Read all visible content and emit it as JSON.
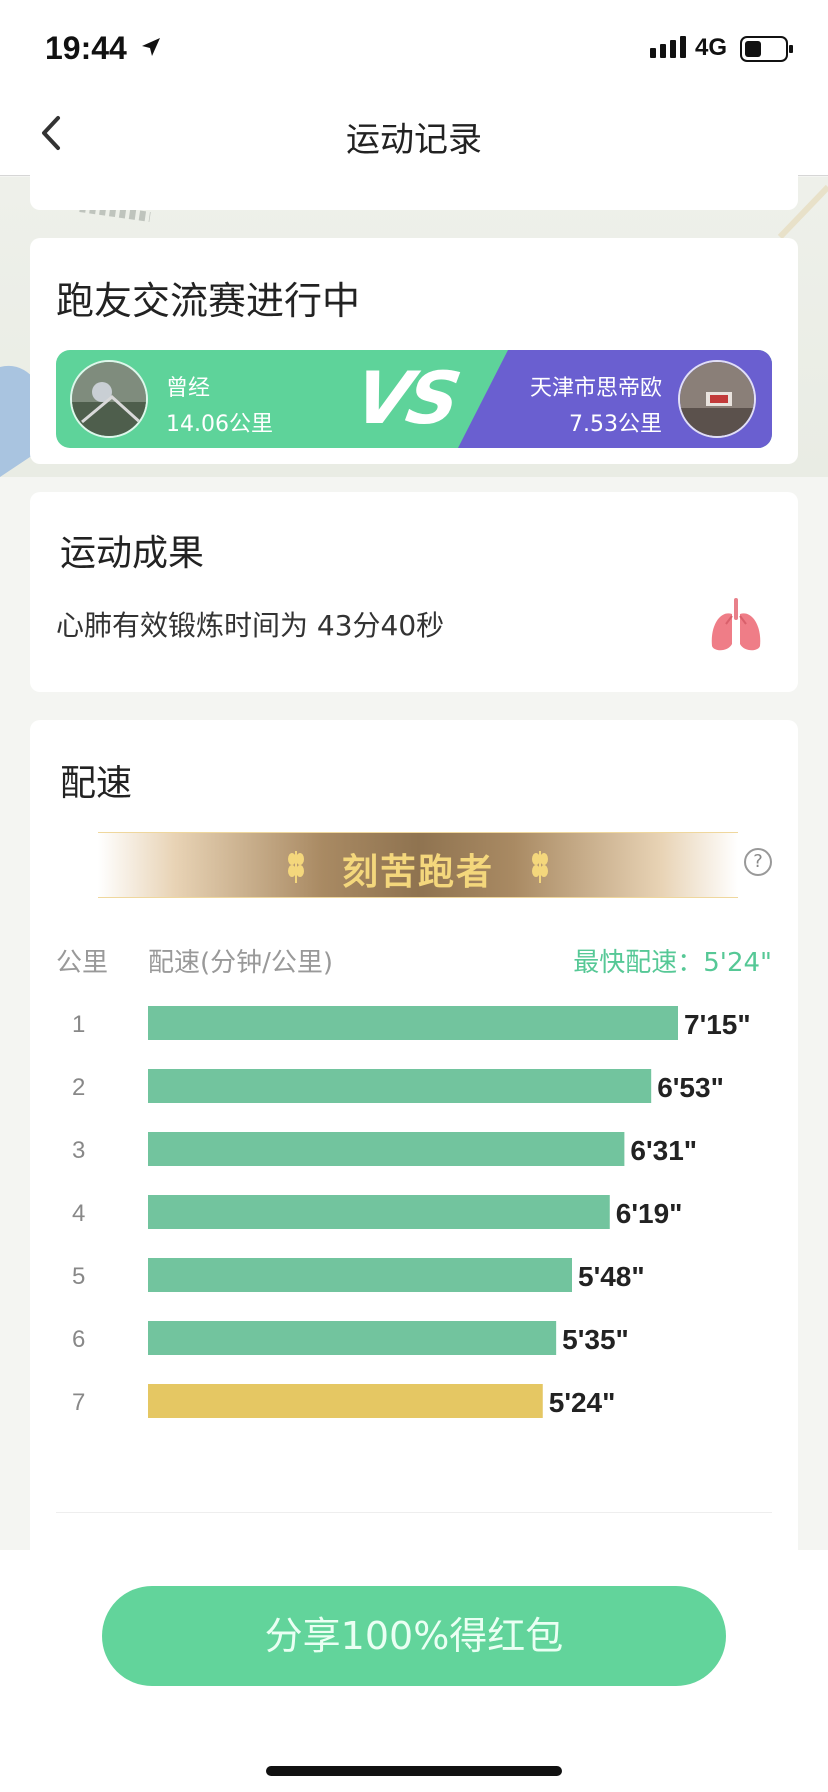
{
  "status_bar": {
    "time": "19:44",
    "network": "4G"
  },
  "nav": {
    "title": "运动记录"
  },
  "race": {
    "title": "跑友交流赛进行中",
    "vs_label": "VS",
    "left_runner": {
      "name": "曾经",
      "distance": "14.06公里"
    },
    "right_runner": {
      "name": "天津市思帝欧",
      "distance": "7.53公里"
    },
    "colors": {
      "left": "#5ed39a",
      "right": "#6a5fd0"
    }
  },
  "result": {
    "title": "运动成果",
    "text": "心肺有效锻炼时间为 43分40秒",
    "icon": "lungs-icon"
  },
  "pace": {
    "title": "配速",
    "badge": "刻苦跑者",
    "help": "?",
    "col_km": "公里",
    "col_pace": "配速(分钟/公里)",
    "fastest": "最快配速：5'24\""
  },
  "chart_data": {
    "type": "bar",
    "orientation": "horizontal",
    "categories": [
      "1",
      "2",
      "3",
      "4",
      "5",
      "6",
      "7"
    ],
    "labels": [
      "7'15\"",
      "6'53\"",
      "6'31\"",
      "6'19\"",
      "5'48\"",
      "5'35\"",
      "5'24\""
    ],
    "values_seconds": [
      435,
      413,
      391,
      379,
      348,
      335,
      324
    ],
    "highlight_index": 6,
    "colors": {
      "normal": "#72c49e",
      "highlight": "#e5c763"
    }
  },
  "share": {
    "label": "分享100%得红包"
  }
}
